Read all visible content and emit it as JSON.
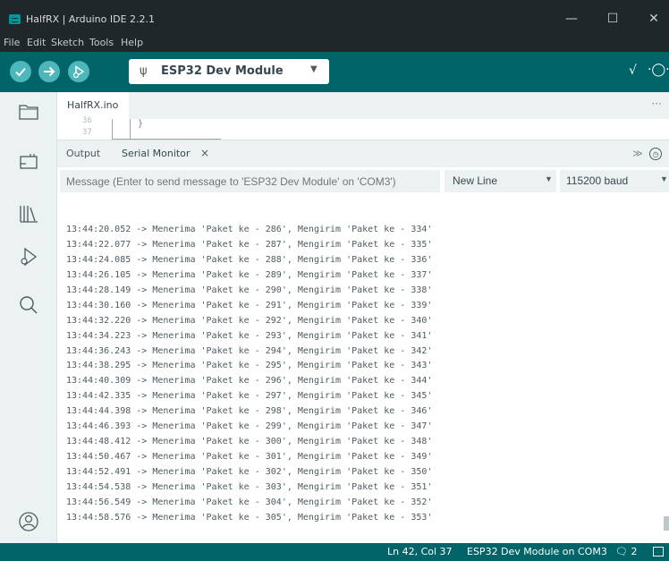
{
  "window": {
    "title": "HalfRX | Arduino IDE 2.2.1",
    "minimize_icon": "minimize-icon",
    "maximize_icon": "maximize-icon",
    "close_icon": "close-icon"
  },
  "menubar": {
    "items": [
      "File",
      "Edit",
      "Sketch",
      "Tools",
      "Help"
    ]
  },
  "toolbar": {
    "board": "ESP32 Dev Module",
    "accent": "#006468",
    "button_color": "#4db7bb"
  },
  "editor": {
    "tab": "HalfRX.ino",
    "more": "···",
    "line_numbers": [
      "36",
      "37"
    ],
    "brace": "}"
  },
  "panel": {
    "tabs": [
      "Output",
      "Serial Monitor"
    ],
    "close": "×"
  },
  "serial": {
    "placeholder": "Message (Enter to send message to 'ESP32 Dev Module' on 'COM3')",
    "line_ending": "New Line",
    "baud": "115200 baud",
    "lines": [
      "13:44:20.052 -> Menerima 'Paket ke - 286', Mengirim 'Paket ke - 334'",
      "13:44:22.077 -> Menerima 'Paket ke - 287', Mengirim 'Paket ke - 335'",
      "13:44:24.085 -> Menerima 'Paket ke - 288', Mengirim 'Paket ke - 336'",
      "13:44:26.105 -> Menerima 'Paket ke - 289', Mengirim 'Paket ke - 337'",
      "13:44:28.149 -> Menerima 'Paket ke - 290', Mengirim 'Paket ke - 338'",
      "13:44:30.160 -> Menerima 'Paket ke - 291', Mengirim 'Paket ke - 339'",
      "13:44:32.220 -> Menerima 'Paket ke - 292', Mengirim 'Paket ke - 340'",
      "13:44:34.223 -> Menerima 'Paket ke - 293', Mengirim 'Paket ke - 341'",
      "13:44:36.243 -> Menerima 'Paket ke - 294', Mengirim 'Paket ke - 342'",
      "13:44:38.295 -> Menerima 'Paket ke - 295', Mengirim 'Paket ke - 343'",
      "13:44:40.309 -> Menerima 'Paket ke - 296', Mengirim 'Paket ke - 344'",
      "13:44:42.335 -> Menerima 'Paket ke - 297', Mengirim 'Paket ke - 345'",
      "13:44:44.398 -> Menerima 'Paket ke - 298', Mengirim 'Paket ke - 346'",
      "13:44:46.393 -> Menerima 'Paket ke - 299', Mengirim 'Paket ke - 347'",
      "13:44:48.412 -> Menerima 'Paket ke - 300', Mengirim 'Paket ke - 348'",
      "13:44:50.467 -> Menerima 'Paket ke - 301', Mengirim 'Paket ke - 349'",
      "13:44:52.491 -> Menerima 'Paket ke - 302', Mengirim 'Paket ke - 350'",
      "13:44:54.538 -> Menerima 'Paket ke - 303', Mengirim 'Paket ke - 351'",
      "13:44:56.549 -> Menerima 'Paket ke - 304', Mengirim 'Paket ke - 352'",
      "13:44:58.576 -> Menerima 'Paket ke - 305', Mengirim 'Paket ke - 353'"
    ]
  },
  "statusbar": {
    "position": "Ln 42, Col 37",
    "board": "ESP32 Dev Module on COM3",
    "notifications": "2"
  }
}
